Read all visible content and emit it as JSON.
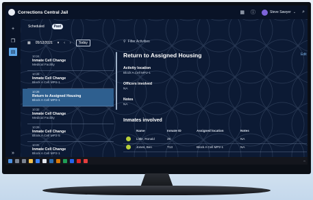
{
  "app": {
    "title": "Corrections Central Jail"
  },
  "topbar": {
    "user_name": "Steve Sawyer",
    "icons": [
      "grid-icon",
      "info-icon",
      "search-icon"
    ]
  },
  "tabs": [
    {
      "label": "Scheduled",
      "active": false
    },
    {
      "label": "Past",
      "active": true
    }
  ],
  "date_picker": {
    "value": "05/12/2021",
    "today_label": "Today"
  },
  "activities": [
    {
      "time": "10:24",
      "title": "Inmate Cell Change",
      "location": "Medical Facility",
      "selected": false
    },
    {
      "time": "10:26",
      "title": "Inmate Cell Change",
      "location": "Block A Cell MP2-1",
      "selected": false
    },
    {
      "time": "10:26",
      "title": "Return to Assigned Housing",
      "location": "Block A Cell MP2-1",
      "selected": true
    },
    {
      "time": "10:32",
      "title": "Inmate Cell Change",
      "location": "Medical Facility",
      "selected": false
    },
    {
      "time": "10:29",
      "title": "Inmate Cell Change",
      "location": "Block A Cell MP2-5",
      "selected": false
    },
    {
      "time": "10:31",
      "title": "Inmate Cell Change",
      "location": "Block A Cell MP2-1",
      "selected": false
    }
  ],
  "filter_label": "Filter Activities",
  "detail": {
    "title": "Return to Assigned Housing",
    "edit_label": "Edit",
    "activity_location_label": "Activity location",
    "activity_location_value": "Block A Cell MP2-1",
    "officers_label": "Officers involved",
    "officers_value": "NA",
    "notes_label": "Notes",
    "notes_value": "NA"
  },
  "inmates": {
    "title": "Inmates involved",
    "columns": [
      "Name",
      "Inmate ID",
      "Assigned location",
      "Notes"
    ],
    "rows": [
      {
        "name": "Little, Ronald",
        "id": "25",
        "location": "",
        "notes": "NA"
      },
      {
        "name": "Jones, Ben",
        "id": "T13",
        "location": "Block A Cell MP2-1",
        "notes": "NA"
      }
    ]
  },
  "colors": {
    "background": "#0c1a34",
    "accent": "#5ea7e8",
    "selected_row": "#2e5f8f",
    "avatar": "#b9cf3a"
  }
}
